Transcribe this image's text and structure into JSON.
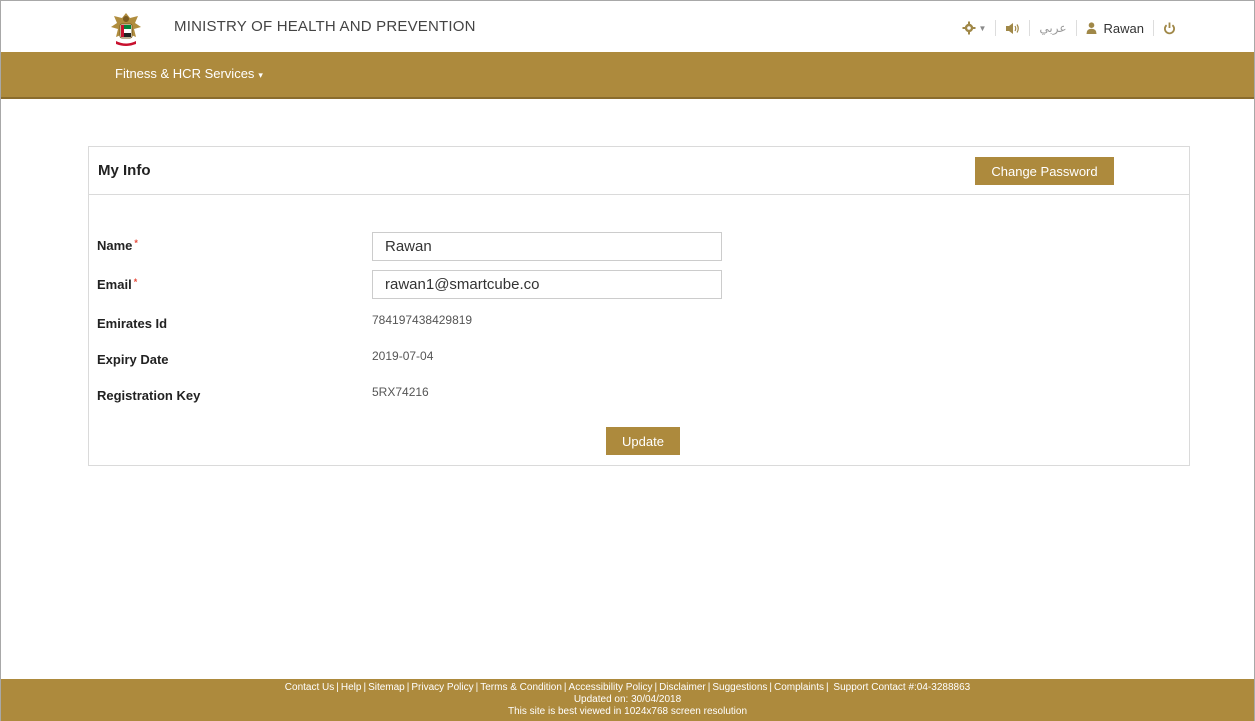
{
  "header": {
    "title": "MINISTRY OF HEALTH AND PREVENTION",
    "language_toggle": "عربي",
    "user_name": "Rawan",
    "icons": [
      "settings-gear-icon",
      "speaker-icon",
      "user-icon",
      "power-icon"
    ]
  },
  "nav": {
    "menu_label": "Fitness & HCR Services"
  },
  "panel": {
    "title": "My Info",
    "change_password_label": "Change Password",
    "fields": {
      "name_label": "Name",
      "name_value": "Rawan",
      "email_label": "Email",
      "email_value": "rawan1@smartcube.co",
      "emirates_id_label": "Emirates Id",
      "emirates_id_value": "784197438429819",
      "expiry_label": "Expiry Date",
      "expiry_value": "2019-07-04",
      "regkey_label": "Registration Key",
      "regkey_value": "5RX74216"
    },
    "required_mark": "*",
    "update_label": "Update"
  },
  "footer": {
    "links": [
      "Contact Us",
      "Help",
      "Sitemap",
      "Privacy Policy",
      "Terms & Condition",
      "Accessibility Policy",
      "Disclaimer",
      "Suggestions",
      "Complaints"
    ],
    "support": "Support Contact #:04-3288863",
    "updated": "Updated on: 30/04/2018",
    "resolution_note": "This site is best viewed in 1024x768 screen resolution"
  },
  "colors": {
    "brand_gold": "#ad8a3d",
    "required_red": "#e74c3c"
  }
}
